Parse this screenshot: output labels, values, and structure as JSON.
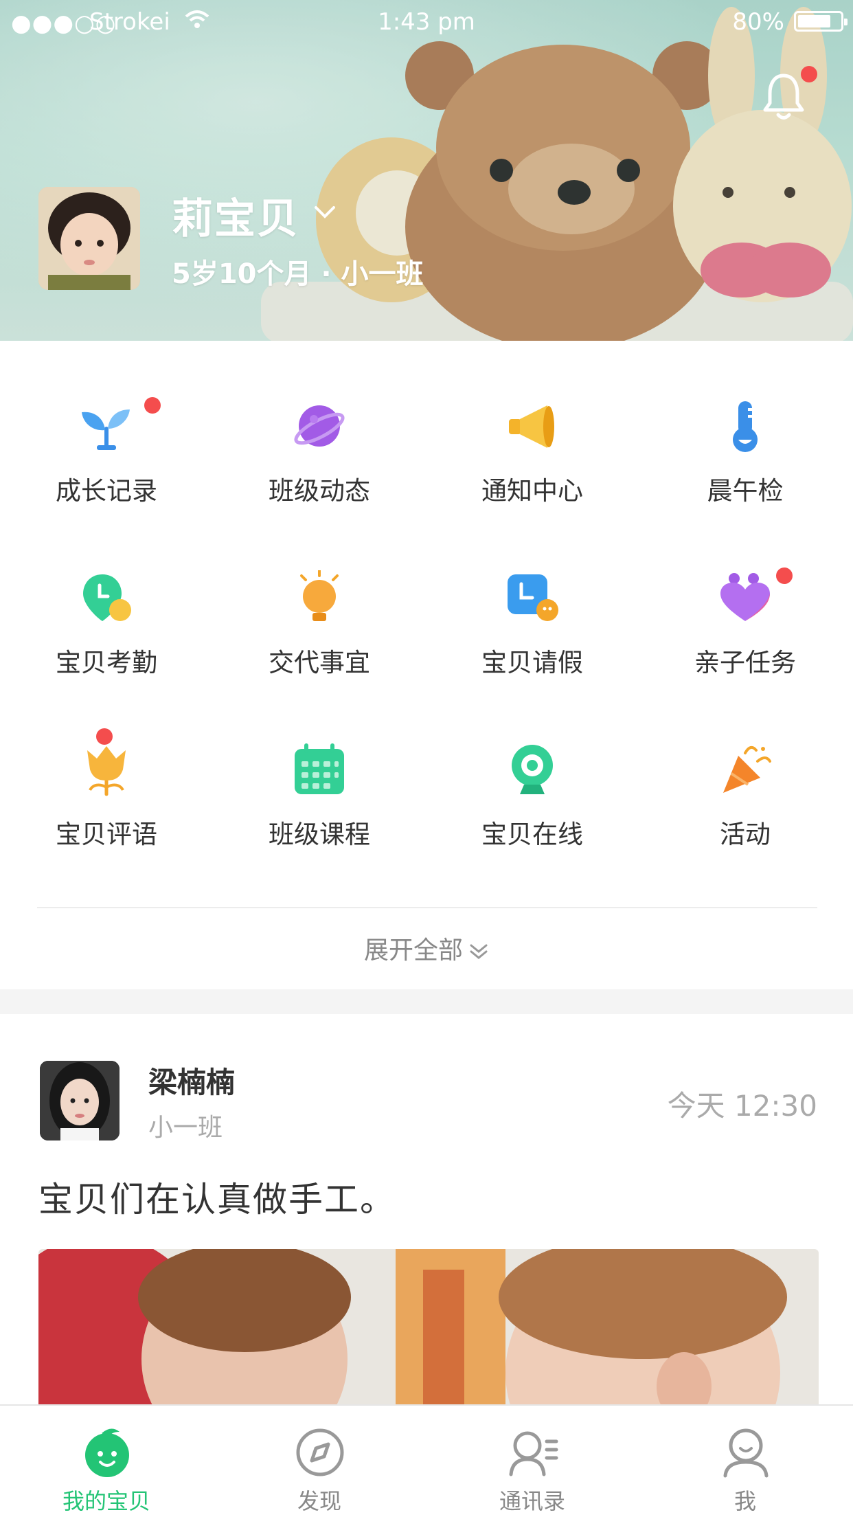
{
  "status_bar": {
    "signal": "●●●○○",
    "carrier": "Strokei",
    "time": "1:43 pm",
    "battery": "80%",
    "battery_level": 0.8
  },
  "header": {
    "child_name": "莉宝贝",
    "child_info": "5岁10个月 · 小一班",
    "notification_badge": true
  },
  "grid": {
    "items": [
      {
        "label": "成长记录",
        "icon": "sprout-icon",
        "badge": true
      },
      {
        "label": "班级动态",
        "icon": "planet-icon",
        "badge": false
      },
      {
        "label": "通知中心",
        "icon": "megaphone-icon",
        "badge": false
      },
      {
        "label": "晨午检",
        "icon": "thermometer-icon",
        "badge": false
      },
      {
        "label": "宝贝考勤",
        "icon": "attendance-pin-icon",
        "badge": false
      },
      {
        "label": "交代事宜",
        "icon": "lightbulb-icon",
        "badge": false
      },
      {
        "label": "宝贝请假",
        "icon": "leave-clock-icon",
        "badge": false
      },
      {
        "label": "亲子任务",
        "icon": "heart-icon",
        "badge": true
      },
      {
        "label": "宝贝评语",
        "icon": "tulip-icon",
        "badge": true
      },
      {
        "label": "班级课程",
        "icon": "calendar-icon",
        "badge": false
      },
      {
        "label": "宝贝在线",
        "icon": "webcam-icon",
        "badge": false
      },
      {
        "label": "活动",
        "icon": "party-popper-icon",
        "badge": false
      }
    ],
    "expand_label": "展开全部"
  },
  "feed": {
    "author": "梁楠楠",
    "class_name": "小一班",
    "time": "今天 12:30",
    "text": "宝贝们在认真做手工。"
  },
  "tabbar": {
    "items": [
      {
        "label": "我的宝贝",
        "icon": "baby-face-icon",
        "active": true
      },
      {
        "label": "发现",
        "icon": "compass-icon",
        "active": false
      },
      {
        "label": "通讯录",
        "icon": "contacts-icon",
        "active": false
      },
      {
        "label": "我",
        "icon": "person-icon",
        "active": false
      }
    ]
  },
  "colors": {
    "accent": "#23c475",
    "badge": "#f44d4d",
    "header_bg": "#b9ddd3"
  }
}
